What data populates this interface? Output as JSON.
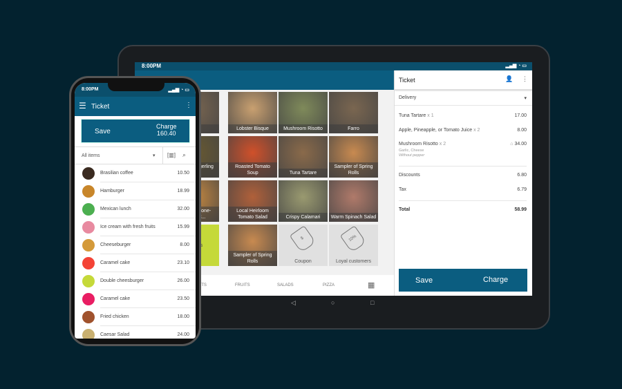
{
  "tablet": {
    "status_time": "8:00PM",
    "grid": [
      {
        "label": "Farro",
        "color": "#7a6650"
      },
      {
        "label": "Lobster Bisque",
        "color": "#c9a070"
      },
      {
        "label": "Mushroom Risotto",
        "color": "#7f8a5a"
      },
      {
        "label": "Farro",
        "color": "#7a6650"
      },
      {
        "label": "Roasted Fingerling Potat...",
        "color": "#6a5a30"
      },
      {
        "label": "Roasted Tomato Soup",
        "color": "#d0502a"
      },
      {
        "label": "Tuna Tartare",
        "color": "#8a6a4a"
      },
      {
        "label": "Sampler of Spring Rolls",
        "color": "#c88a50"
      },
      {
        "label": "Shrimp & Stone-Ground C...",
        "color": "#c98a40"
      },
      {
        "label": "Local Heirloom Tomato Salad",
        "color": "#b0603a"
      },
      {
        "label": "Crispy Calamari",
        "color": "#9a9a70"
      },
      {
        "label": "Warm Spinach Salad",
        "color": "#b07a6a"
      },
      {
        "label": "Desserts",
        "color": "#c5d939",
        "type": "category"
      },
      {
        "label": "Sampler of Spring Rolls",
        "color": "#c88a50"
      },
      {
        "label": "Coupon",
        "type": "discount",
        "tag": "$"
      },
      {
        "label": "Loyal customers",
        "type": "discount",
        "tag": "10%"
      }
    ],
    "bottom_nav": [
      "RTS",
      "FRUITS",
      "SALADS",
      "PIZZA"
    ],
    "ticket": {
      "title": "Ticket",
      "dining_option": "Delivery",
      "items": [
        {
          "name": "Tuna Tartare",
          "qty": "x 1",
          "price": "17.00"
        },
        {
          "name": "Apple, Pineapple, or Tomato Juice",
          "qty": "x 2",
          "price": "8.00"
        },
        {
          "name": "Mushroom Risotto",
          "qty": "x 2",
          "price": "34.00",
          "modifiers": "Garlic, Cheese",
          "comment": "Without pepper"
        }
      ],
      "discounts_label": "Discounts",
      "discounts": "6.80",
      "tax_label": "Tax",
      "tax": "6.79",
      "total_label": "Total",
      "total": "58.99",
      "save": "Save",
      "charge": "Charge"
    }
  },
  "phone": {
    "status_time": "8:00PM",
    "title": "Ticket",
    "save": "Save",
    "charge": "Charge",
    "charge_amount": "160.40",
    "filter": "All items",
    "items": [
      {
        "name": "Brasilian coffee",
        "price": "10.50",
        "color": "#3a2a20"
      },
      {
        "name": "Hamburger",
        "price": "18.99",
        "color": "#c8862a"
      },
      {
        "name": "Mexican lunch",
        "price": "32.00",
        "color": "#4caf50"
      },
      {
        "name": "Ice cream with fresh fruits",
        "price": "15.99",
        "color": "#e88aa0"
      },
      {
        "name": "Cheeseburger",
        "price": "8.00",
        "color": "#d49a3a"
      },
      {
        "name": "Caramel cake",
        "price": "23.10",
        "color": "#f44336"
      },
      {
        "name": "Double cheesburger",
        "price": "26.00",
        "color": "#c5d939"
      },
      {
        "name": "Caramel cake",
        "price": "23.50",
        "color": "#e91e63"
      },
      {
        "name": "Fried chicken",
        "price": "18.00",
        "color": "#a0522d"
      },
      {
        "name": "Caesar Salad",
        "price": "24.00",
        "color": "#c9b070"
      }
    ]
  }
}
